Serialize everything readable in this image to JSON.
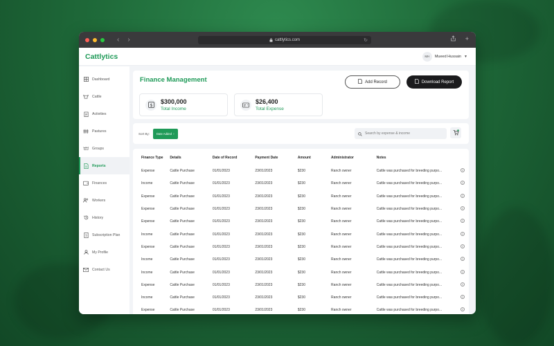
{
  "browser": {
    "url": "cattlytics.com"
  },
  "app": {
    "brand": "Cattlytics",
    "user": {
      "initials": "MH",
      "name": "Mueed Hussain"
    }
  },
  "sidebar": {
    "items": [
      {
        "label": "Dashboard",
        "icon": "grid-icon"
      },
      {
        "label": "Cattle",
        "icon": "cattle-icon"
      },
      {
        "label": "Activities",
        "icon": "clipboard-icon"
      },
      {
        "label": "Pastures",
        "icon": "fence-icon"
      },
      {
        "label": "Groups",
        "icon": "group-icon"
      },
      {
        "label": "Reports",
        "icon": "document-icon",
        "active": true
      },
      {
        "label": "Finances",
        "icon": "wallet-icon"
      },
      {
        "label": "Workers",
        "icon": "users-icon"
      },
      {
        "label": "History",
        "icon": "history-icon"
      },
      {
        "label": "Subscription Plan",
        "icon": "subscription-icon"
      },
      {
        "label": "My Profile",
        "icon": "user-icon"
      },
      {
        "label": "Contact Us",
        "icon": "mail-icon"
      }
    ]
  },
  "header": {
    "title": "Finance Management",
    "add_record": "Add Record",
    "download_report": "Download Report"
  },
  "stats": {
    "income": {
      "value": "$300,000",
      "label": "Total Income"
    },
    "expense": {
      "value": "$26,400",
      "label": "Total Expense"
    }
  },
  "filter": {
    "sort_label": "Sort By:",
    "sort_value": "Date Added",
    "search_placeholder": "Search by expense & income"
  },
  "table": {
    "columns": [
      "Finance Type",
      "Details",
      "Date of Record",
      "Payment Date",
      "Amount",
      "Administrator",
      "Notes"
    ],
    "rows": [
      [
        "Expense",
        "Cattle Purchase",
        "01/01/2023",
        "23/01/2023",
        "$230",
        "Ranch owner",
        "Cattle was purchased for breeding purpo..."
      ],
      [
        "Income",
        "Cattle Purchase",
        "01/01/2023",
        "23/01/2023",
        "$230",
        "Ranch owner",
        "Cattle was purchased for breeding purpo..."
      ],
      [
        "Expense",
        "Cattle Purchase",
        "01/01/2023",
        "23/01/2023",
        "$230",
        "Ranch owner",
        "Cattle was purchased for breeding purpo..."
      ],
      [
        "Expense",
        "Cattle Purchase",
        "01/01/2023",
        "23/01/2023",
        "$230",
        "Ranch owner",
        "Cattle was purchased for breeding purpo..."
      ],
      [
        "Expense",
        "Cattle Purchase",
        "01/01/2023",
        "23/01/2023",
        "$230",
        "Ranch owner",
        "Cattle was purchased for breeding purpo..."
      ],
      [
        "Income",
        "Cattle Purchase",
        "01/01/2023",
        "23/01/2023",
        "$230",
        "Ranch owner",
        "Cattle was purchased for breeding purpo..."
      ],
      [
        "Expense",
        "Cattle Purchase",
        "01/01/2023",
        "23/01/2023",
        "$230",
        "Ranch owner",
        "Cattle was purchased for breeding purpo..."
      ],
      [
        "Income",
        "Cattle Purchase",
        "01/01/2023",
        "23/01/2023",
        "$230",
        "Ranch owner",
        "Cattle was purchased for breeding purpo..."
      ],
      [
        "Income",
        "Cattle Purchase",
        "01/01/2023",
        "23/01/2023",
        "$230",
        "Ranch owner",
        "Cattle was purchased for breeding purpo..."
      ],
      [
        "Expense",
        "Cattle Purchase",
        "01/01/2023",
        "23/01/2023",
        "$230",
        "Ranch owner",
        "Cattle was purchased for breeding purpo..."
      ],
      [
        "Income",
        "Cattle Purchase",
        "01/01/2023",
        "23/01/2023",
        "$230",
        "Ranch owner",
        "Cattle was purchased for breeding purpo..."
      ],
      [
        "Expense",
        "Cattle Purchase",
        "01/01/2023",
        "23/01/2023",
        "$230",
        "Ranch owner",
        "Cattle was purchased for breeding purpo..."
      ]
    ]
  },
  "colors": {
    "accent": "#1f9a58",
    "dark_button": "#1b1b1d",
    "window_chrome": "#3a3a3c"
  }
}
